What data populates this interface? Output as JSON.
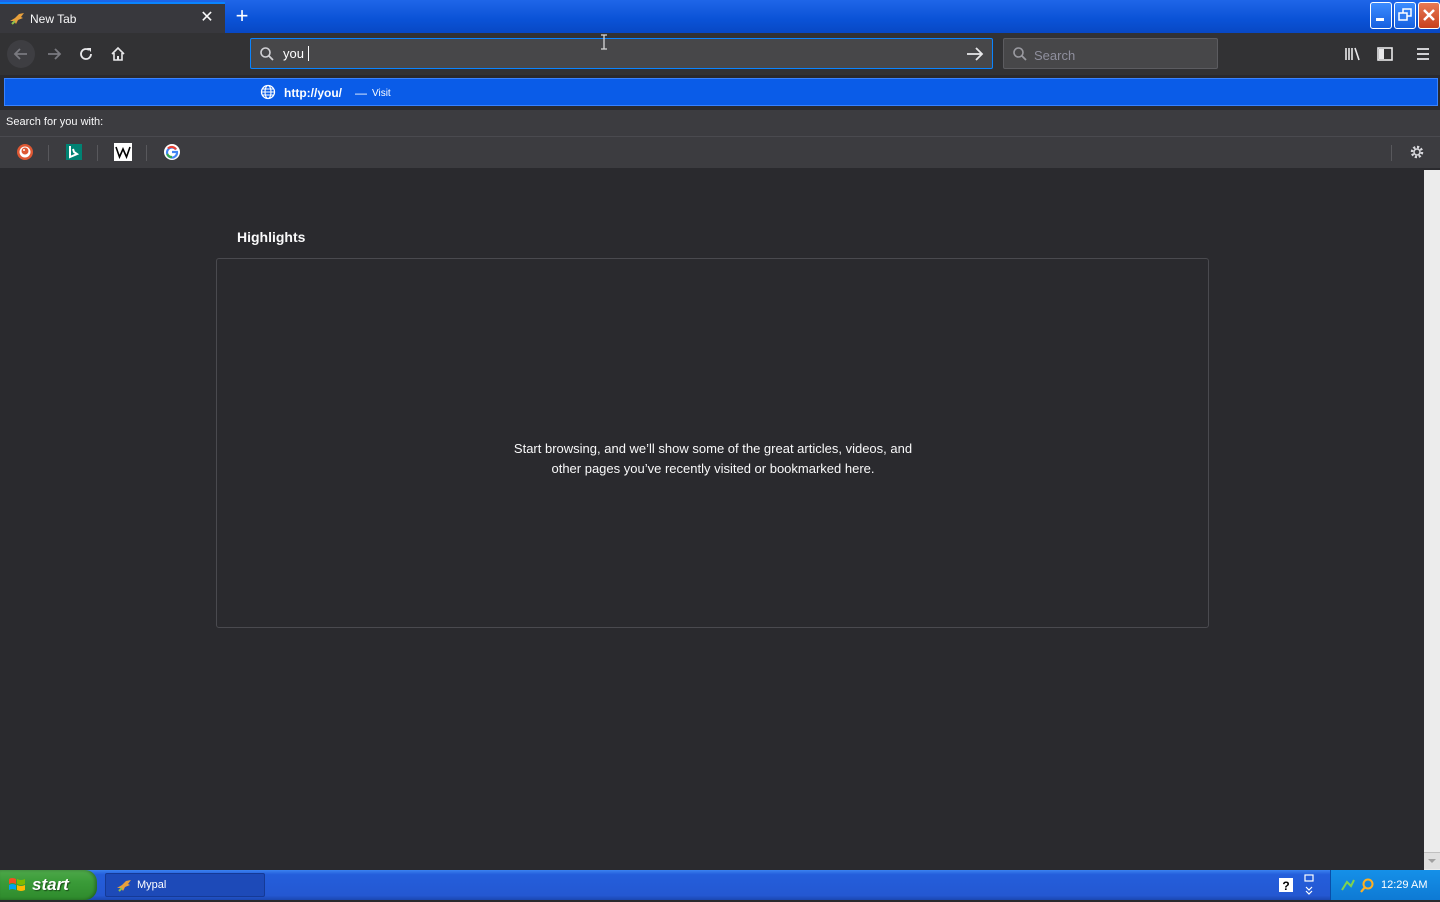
{
  "browser": {
    "tab": {
      "title": "New Tab",
      "close_symbol": "✕"
    },
    "new_tab_symbol": "+",
    "window_controls": [
      "minimize",
      "restore",
      "close"
    ]
  },
  "toolbar": {
    "url_value": "you",
    "search_placeholder": "Search"
  },
  "autocomplete": {
    "url": "http://you/",
    "separator": "—",
    "action": "Visit"
  },
  "one_off_search": {
    "label": "Search for you  with:",
    "engines": [
      "duckduckgo",
      "bing",
      "wikipedia",
      "google"
    ]
  },
  "newtab": {
    "section_title": "Highlights",
    "empty_message": "Start browsing, and we’ll show some of the great articles, videos, and other pages you’ve recently visited or bookmarked here."
  },
  "taskbar": {
    "start_label": "start",
    "window_label": "Mypal",
    "help_symbol": "?",
    "clock": "12:29 AM"
  },
  "colors": {
    "accent": "#0a84ff",
    "content_bg": "#2a2a2e",
    "toolbar_bg": "#323234",
    "xp_blue": "#245edb",
    "start_green": "#3a9b38"
  }
}
